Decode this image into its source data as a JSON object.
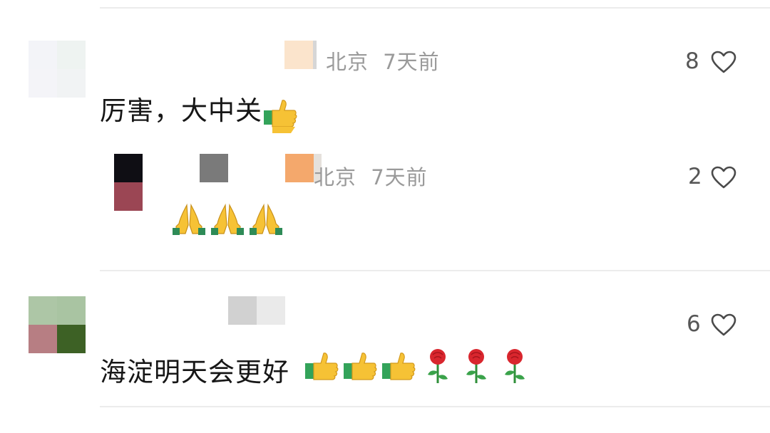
{
  "comments": [
    {
      "location": "北京",
      "time": "7天前",
      "likes": "8",
      "text": "厉害，大中关"
    },
    {
      "location": "北京",
      "time": "7天前",
      "likes": "2",
      "text": ""
    },
    {
      "likes": "6",
      "text": "海淀明天会更好"
    }
  ],
  "icons": {
    "like": "heart-outline-icon",
    "thumbs_up": "thumbs-up-emoji",
    "pray": "folded-hands-emoji",
    "rose": "rose-emoji"
  },
  "colors": {
    "meta_gray": "#9a9a9a",
    "divider": "#ececec"
  }
}
